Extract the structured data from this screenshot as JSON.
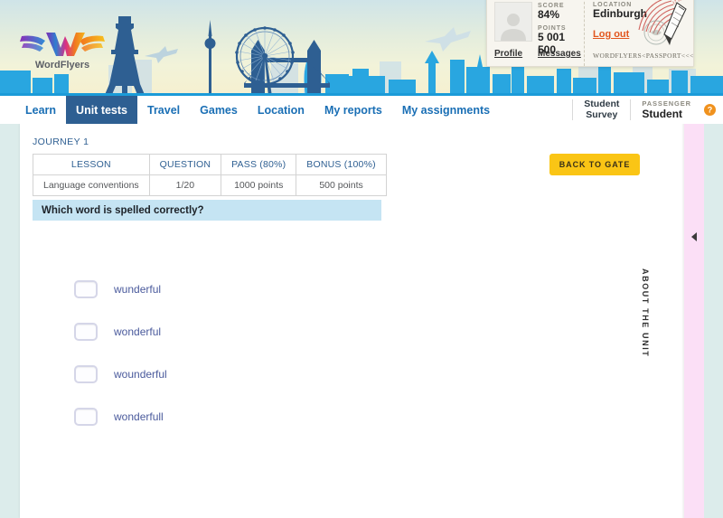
{
  "brand": {
    "name": "WordFlyers",
    "logo_icon": "wordflyers-winged-w-logo"
  },
  "passport": {
    "avatar_icon": "user-avatar-placeholder",
    "score_label": "SCORE",
    "score_value": "84%",
    "points_label": "POINTS",
    "points_value": "5 001 500",
    "profile_link": "Profile",
    "messages_link": "Messages",
    "location_label": "LOCATION",
    "location_value": "Edinburgh",
    "logout_link": "Log out",
    "mrz_line": "WORDFLYERS<PASSPORT<<<<<",
    "logout_color": "#e2561e"
  },
  "nav": {
    "tabs": [
      {
        "label": "Learn",
        "active": false
      },
      {
        "label": "Unit tests",
        "active": true
      },
      {
        "label": "Travel",
        "active": false
      },
      {
        "label": "Games",
        "active": false
      },
      {
        "label": "Location",
        "active": false
      },
      {
        "label": "My reports",
        "active": false
      },
      {
        "label": "My assignments",
        "active": false
      }
    ],
    "survey_line1": "Student",
    "survey_line2": "Survey",
    "passenger_label": "PASSENGER",
    "passenger_name": "Student",
    "help_icon": "help-question-icon",
    "active_tab_color": "#2e5f92",
    "link_color": "#1a6fb5"
  },
  "main": {
    "journey_label": "JOURNEY 1",
    "table": {
      "headers": [
        "LESSON",
        "QUESTION",
        "PASS (80%)",
        "BONUS (100%)"
      ],
      "rows": [
        [
          "Language conventions",
          "1/20",
          "1000 points",
          "500 points"
        ]
      ]
    },
    "back_to_gate": "BACK TO GATE",
    "back_to_gate_color": "#fac515",
    "question_text": "Which word is spelled correctly?",
    "question_bar_color": "#c5e4f3",
    "options": [
      {
        "label": "wunderful",
        "checked": false
      },
      {
        "label": "wonderful",
        "checked": false
      },
      {
        "label": "wounderful",
        "checked": false
      },
      {
        "label": "wonderfull",
        "checked": false
      }
    ]
  },
  "about_rail": {
    "text": "ABOUT THE UNIT",
    "arrow_icon": "chevron-left-icon",
    "color": "#fbdff6"
  }
}
